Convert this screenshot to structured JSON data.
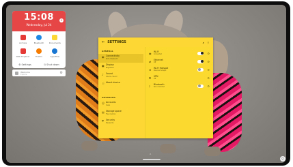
{
  "clock_widget": {
    "time": "15:08",
    "date": "Wednesday, Jul 24",
    "apps": [
      {
        "label": "Archive",
        "icon": "archive-icon",
        "color": "#e53935"
      },
      {
        "label": "Bluetooth",
        "icon": "bluetooth-icon",
        "color": "#1e88e5"
      },
      {
        "label": "Documents",
        "icon": "documents-icon",
        "color": "#fdd835"
      },
      {
        "label": "Web Explorer",
        "icon": "web-explorer-icon",
        "color": "#e53935"
      },
      {
        "label": "Firefox",
        "icon": "firefox-icon",
        "color": "#f57c00"
      },
      {
        "label": "Appsflow",
        "icon": "appsflow-icon",
        "color": "#1976d2"
      }
    ],
    "actions": {
      "settings": "Settings",
      "shutdown": "Shut down"
    }
  },
  "search_card": {
    "title": "Welcome",
    "subtitle": "Explore"
  },
  "settings": {
    "title": "SETTINGS",
    "left_sections": [
      {
        "label": "GENERAL",
        "items": [
          {
            "label": "Connectivity",
            "sub": "Wi-Fi, Bluetooth",
            "icon": "wifi-icon",
            "selected": true
          },
          {
            "label": "Display",
            "sub": "Brightness",
            "icon": "display-icon",
            "selected": false
          },
          {
            "label": "Sound",
            "sub": "Volume, Sound",
            "icon": "sound-icon",
            "selected": false
          },
          {
            "label": "About device",
            "sub": "",
            "icon": "info-icon",
            "selected": false
          }
        ]
      },
      {
        "label": "ADVANCED",
        "items": [
          {
            "label": "Accounts",
            "sub": "Users",
            "icon": "account-icon",
            "selected": false
          },
          {
            "label": "Storage space",
            "sub": "Free memory",
            "icon": "storage-icon",
            "selected": false
          },
          {
            "label": "Security",
            "sub": "Passwords",
            "icon": "security-icon",
            "selected": false
          }
        ]
      }
    ],
    "right_items": [
      {
        "label": "Wi-Fi",
        "sub": "Connected",
        "icon": "wifi-icon",
        "toggle": true
      },
      {
        "label": "Ethernet",
        "sub": "Off",
        "icon": "ethernet-icon",
        "toggle": true
      },
      {
        "label": "Wi-Fi Hotspot",
        "sub": "Personal hotspot",
        "icon": "hotspot-icon",
        "toggle": false
      },
      {
        "label": "VPN",
        "sub": "Off",
        "icon": "vpn-icon",
        "toggle": null
      },
      {
        "label": "Bluetooth",
        "sub": "Not connected",
        "icon": "bluetooth-icon",
        "toggle": false
      }
    ]
  }
}
